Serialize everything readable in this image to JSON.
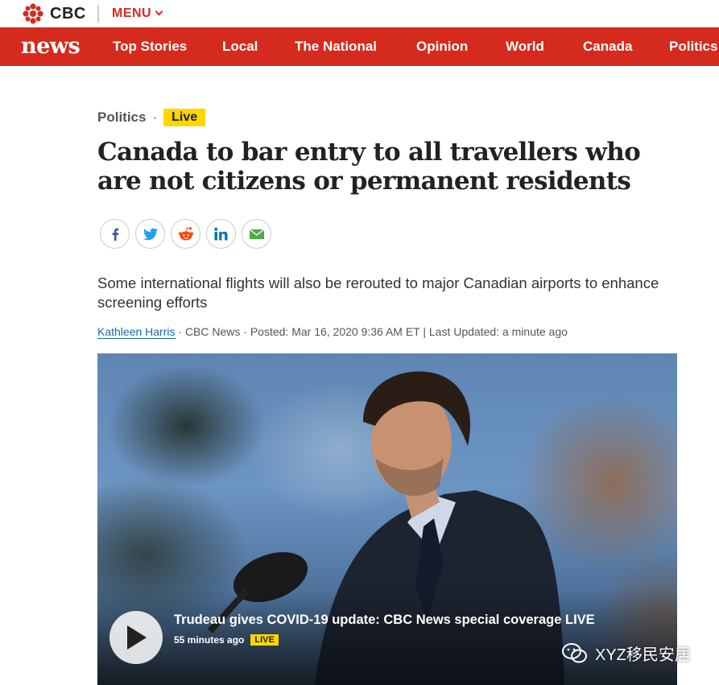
{
  "brand": {
    "name": "CBC",
    "menu_label": "MENU",
    "section_brand": "news"
  },
  "nav": {
    "items": [
      {
        "label": "Top Stories"
      },
      {
        "label": "Local"
      },
      {
        "label": "The National"
      },
      {
        "label": "Opinion"
      },
      {
        "label": "World"
      },
      {
        "label": "Canada"
      },
      {
        "label": "Politics"
      }
    ]
  },
  "article": {
    "section": "Politics",
    "separator": "·",
    "live_tag": "Live",
    "headline": "Canada to bar entry to all travellers who are not citizens or permanent residents",
    "deck": "Some international flights will also be rerouted to major Canadian airports to enhance screening efforts",
    "byline": {
      "author": "Kathleen Harris",
      "rest": " · CBC News · Posted: Mar 16, 2020 9:36 AM ET | Last Updated: a minute ago"
    },
    "share_icons": [
      "facebook-icon",
      "twitter-icon",
      "reddit-icon",
      "linkedin-icon",
      "email-icon"
    ]
  },
  "video": {
    "caption": "Trudeau gives COVID-19 update: CBC News special coverage LIVE",
    "time": "55 minutes ago",
    "live_tag": "LIVE"
  },
  "watermark": {
    "text": "XYZ移民安居"
  },
  "colors": {
    "brand_red": "#d52b1e",
    "live_yellow": "#ffd600",
    "link_blue": "#1c66b3"
  }
}
